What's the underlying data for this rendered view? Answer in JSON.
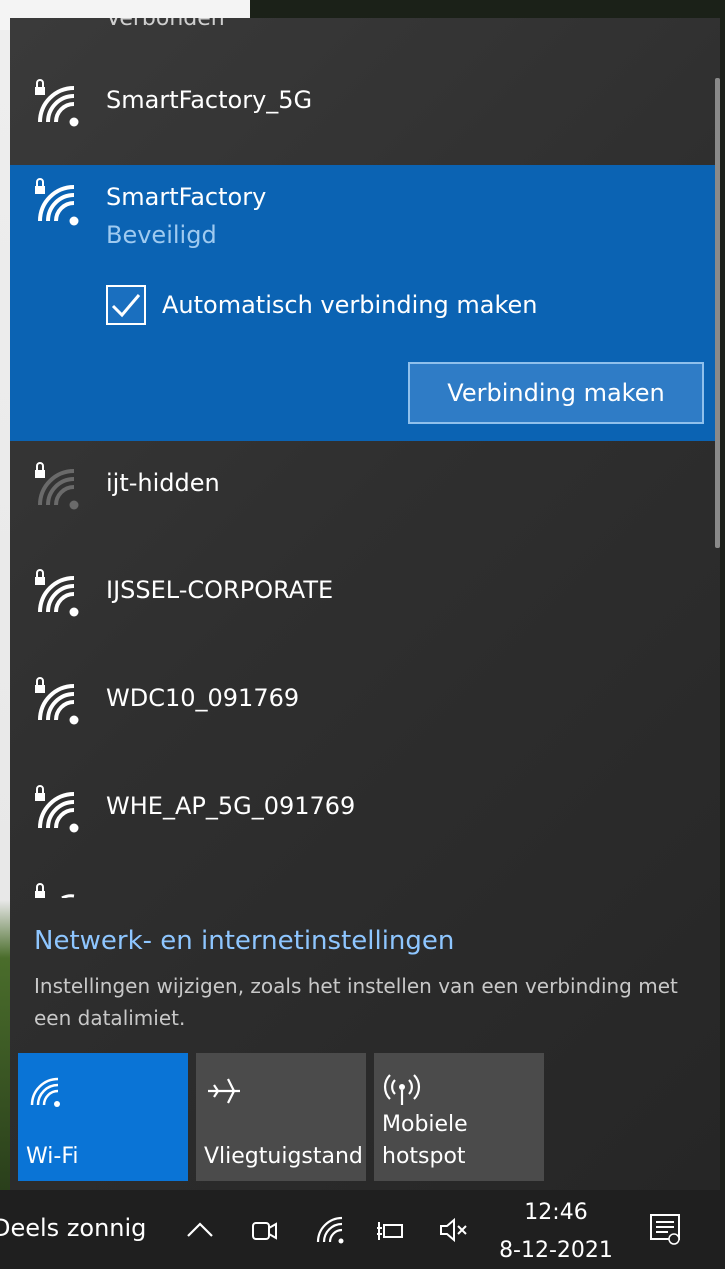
{
  "panel": {
    "scroll_header": "Verbonden",
    "networks": [
      {
        "name": "SmartFactory_5G",
        "secured": true
      },
      {
        "name": "SmartFactory",
        "secured": true,
        "status": "Beveiligd",
        "selected": true
      },
      {
        "name": "ijt-hidden",
        "secured": true,
        "weak": true
      },
      {
        "name": "IJSSEL-CORPORATE",
        "secured": true
      },
      {
        "name": "WDC10_091769",
        "secured": true
      },
      {
        "name": "WHE_AP_5G_091769",
        "secured": true
      }
    ],
    "auto_connect_label": "Automatisch verbinding maken",
    "auto_connect_checked": true,
    "connect_button": "Verbinding maken"
  },
  "settings": {
    "link": "Netwerk- en internetinstellingen",
    "description": "Instellingen wijzigen, zoals het instellen van een verbinding met een datalimiet."
  },
  "quick_actions": [
    {
      "label": "Wi-Fi",
      "icon": "wifi-icon",
      "active": true
    },
    {
      "label": "Vliegtuigstand",
      "icon": "airplane-icon",
      "active": false
    },
    {
      "label": "Mobiele hotspot",
      "icon": "hotspot-icon",
      "active": false
    }
  ],
  "taskbar": {
    "weather": "Deels zonnig",
    "time": "12:46",
    "date": "8-12-2021",
    "icons": [
      "chevron-up-icon",
      "meet-now-icon",
      "wifi-icon",
      "battery-charging-icon",
      "volume-muted-icon",
      "notifications-icon"
    ]
  },
  "colors": {
    "accent": "#0a74d6",
    "selected_bg": "#0b63b3",
    "link": "#8ec6ff",
    "panel_bg": "#2f2f2f"
  }
}
